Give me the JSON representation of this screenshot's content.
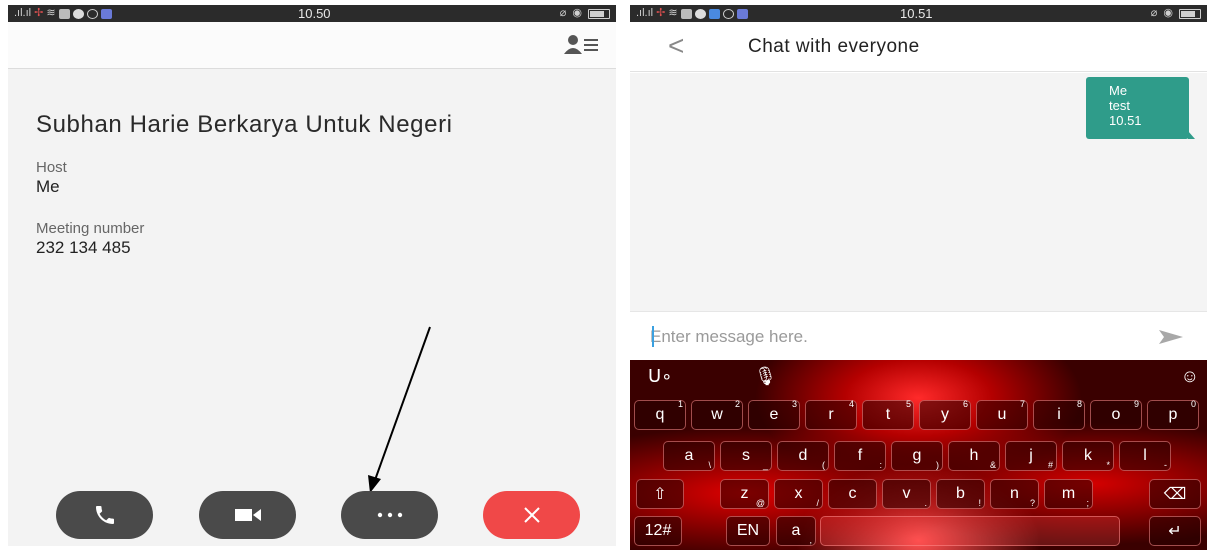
{
  "left_status": {
    "time": "10.50"
  },
  "right_status": {
    "time": "10.51"
  },
  "meeting": {
    "title": "Subhan Harie Berkarya Untuk Negeri",
    "host_label": "Host",
    "host_value": "Me",
    "number_label": "Meeting number",
    "number_value": "232 134 485"
  },
  "call_controls": [
    "phone-icon",
    "video-camera-icon",
    "more-icon",
    "end-call-icon"
  ],
  "colors": {
    "end_call": "#f04848",
    "control_bg": "#4a4a4a",
    "bubble": "#2f9c8a",
    "keyboard": "#b40000"
  },
  "chat": {
    "title": "Chat with everyone",
    "message": {
      "sender": "Me",
      "text": "test",
      "time": "10.51"
    },
    "input_placeholder": "Enter message here."
  },
  "keyboard": {
    "row1": [
      {
        "k": "q",
        "h": "1"
      },
      {
        "k": "w",
        "h": "2"
      },
      {
        "k": "e",
        "h": "3"
      },
      {
        "k": "r",
        "h": "4"
      },
      {
        "k": "t",
        "h": "5"
      },
      {
        "k": "y",
        "h": "6"
      },
      {
        "k": "u",
        "h": "7"
      },
      {
        "k": "i",
        "h": "8"
      },
      {
        "k": "o",
        "h": "9"
      },
      {
        "k": "p",
        "h": "0"
      }
    ],
    "row2": [
      {
        "k": "a",
        "s": "\\"
      },
      {
        "k": "s",
        "s": "_"
      },
      {
        "k": "d",
        "s": "("
      },
      {
        "k": "f",
        "s": ":"
      },
      {
        "k": "g",
        "s": ")"
      },
      {
        "k": "h",
        "s": "&"
      },
      {
        "k": "j",
        "s": "#"
      },
      {
        "k": "k",
        "s": "*"
      },
      {
        "k": "l",
        "s": "-"
      }
    ],
    "row3": [
      {
        "k": "z",
        "s": "@"
      },
      {
        "k": "x",
        "s": "/"
      },
      {
        "k": "c",
        "s": ""
      },
      {
        "k": "v",
        "s": "."
      },
      {
        "k": "b",
        "s": "!"
      },
      {
        "k": "n",
        "s": "?"
      },
      {
        "k": "m",
        "s": ";"
      }
    ],
    "symbols_key": "12#",
    "lang_key": "EN",
    "comma_key": "a",
    "comma_sub": ","
  }
}
